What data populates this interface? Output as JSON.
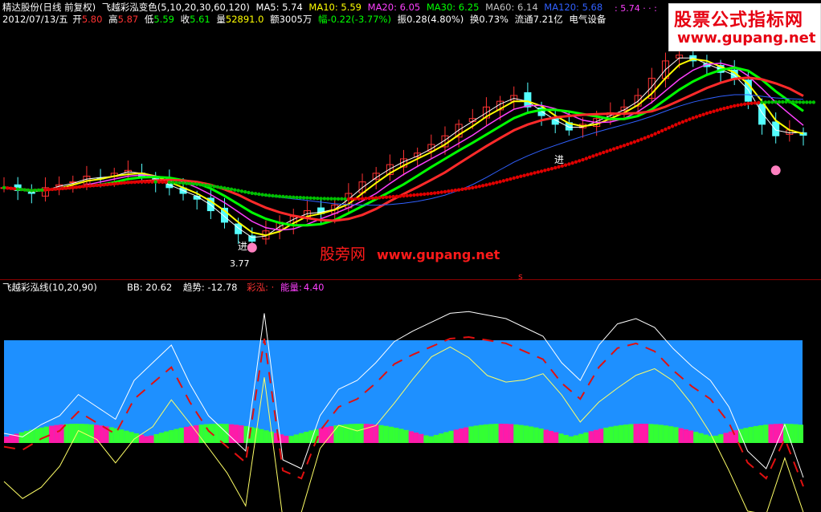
{
  "header": {
    "stock_label": "精达股份(日线 前复权)",
    "indicator_label": "飞越彩泓变色(5,10,20,30,60,120)",
    "ma5": "MA5: 5.74",
    "ma10": "MA10: 5.59",
    "ma20": "MA20: 6.05",
    "ma30": "MA30: 6.25",
    "ma60": "MA60: 6.14",
    "ma120": "MA120: 5.68",
    "date": "2012/07/13/五",
    "open_label": "开",
    "open": "5.80",
    "high_label": "高",
    "high": "5.87",
    "low_label": "低",
    "low": "5.59",
    "close_label": "收",
    "close": "5.61",
    "volume_label": "量",
    "volume": "52891.0",
    "amount": "额3005万",
    "change": "幅-0.22(-3.77%)",
    "amplitude": "振0.28(4.80%)",
    "turnover": "换0.73%",
    "float_cap": "流通7.21亿",
    "sector": "电气设备",
    "right_value": ": 5.74 · · :"
  },
  "watermark": {
    "site_name": "股票公式指标网",
    "site_url": "www.gupang.net",
    "mid_name": "股旁网",
    "mid_url": "www.gupang.net"
  },
  "chart_labels": {
    "low_price": "3.77",
    "buy_signal_1": "进",
    "buy_signal_2": "进",
    "s_mark": "s"
  },
  "indicator": {
    "name": "飞越彩泓线(10,20,90)",
    "bb": "BB: 20.62",
    "trend": "趋势: -12.78",
    "caihong": "彩泓: ·",
    "energy_label": "能量:",
    "energy": "4.40"
  },
  "colors": {
    "up": "#ff3232",
    "down": "#54ffff",
    "ma5": "#ffffff",
    "ma10": "#ffff00",
    "ma20": "#ff40ff",
    "ma30": "#00ff00",
    "ma60": "#c0c0c0",
    "ma120": "#3060ff",
    "panel_blue": "#1e90ff",
    "bar_green": "#33ff33",
    "bar_pink": "#ff1aa8",
    "signal_red": "#e00000",
    "signal_green": "#00c000"
  },
  "chart_data": {
    "type": "line",
    "price_close_series": [
      4.7,
      4.65,
      4.6,
      4.7,
      4.75,
      4.8,
      4.9,
      4.85,
      4.95,
      5.0,
      4.9,
      4.8,
      4.7,
      4.6,
      4.5,
      4.3,
      4.1,
      3.9,
      3.77,
      3.95,
      4.1,
      4.2,
      4.3,
      4.25,
      4.4,
      4.6,
      4.8,
      4.95,
      5.1,
      5.2,
      5.3,
      5.45,
      5.6,
      5.8,
      5.9,
      6.1,
      6.2,
      6.3,
      6.1,
      5.95,
      5.8,
      5.7,
      5.8,
      5.9,
      6.0,
      6.1,
      6.3,
      6.6,
      6.9,
      7.0,
      6.9,
      6.8,
      6.7,
      6.6,
      6.2,
      5.8,
      5.6,
      5.7,
      5.61
    ],
    "indicator_line": [
      30,
      28,
      35,
      40,
      52,
      45,
      38,
      60,
      70,
      80,
      58,
      40,
      30,
      20,
      98,
      15,
      10,
      40,
      55,
      60,
      70,
      82,
      88,
      93,
      98,
      99,
      97,
      95,
      90,
      85,
      70,
      60,
      80,
      92,
      95,
      90,
      78,
      68,
      60,
      45,
      20,
      10,
      35,
      5
    ],
    "low_price": 3.77
  }
}
